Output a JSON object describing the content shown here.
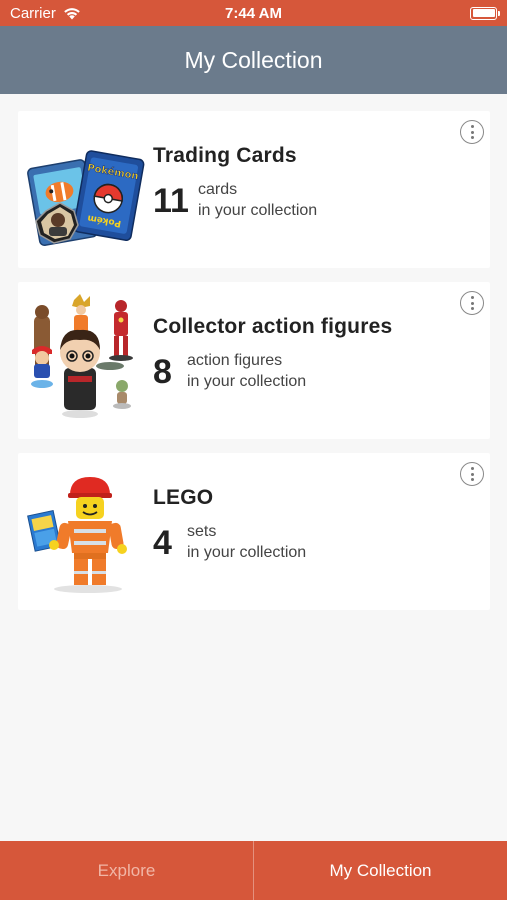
{
  "status_bar": {
    "carrier": "Carrier",
    "time": "7:44 AM"
  },
  "nav": {
    "title": "My Collection"
  },
  "collections": [
    {
      "title": "Trading Cards",
      "count": "11",
      "unit": "cards",
      "suffix": "in your collection",
      "thumbnail": "trading-cards-image"
    },
    {
      "title": "Collector action figures",
      "count": "8",
      "unit": "action figures",
      "suffix": "in your collection",
      "thumbnail": "action-figures-image"
    },
    {
      "title": "LEGO",
      "count": "4",
      "unit": "sets",
      "suffix": "in your collection",
      "thumbnail": "lego-figure-image"
    }
  ],
  "tabs": [
    {
      "label": "Explore",
      "active": false
    },
    {
      "label": "My Collection",
      "active": true
    }
  ],
  "colors": {
    "accent": "#d6573a",
    "nav": "#6b7b8c",
    "background": "#f7f7f7"
  }
}
